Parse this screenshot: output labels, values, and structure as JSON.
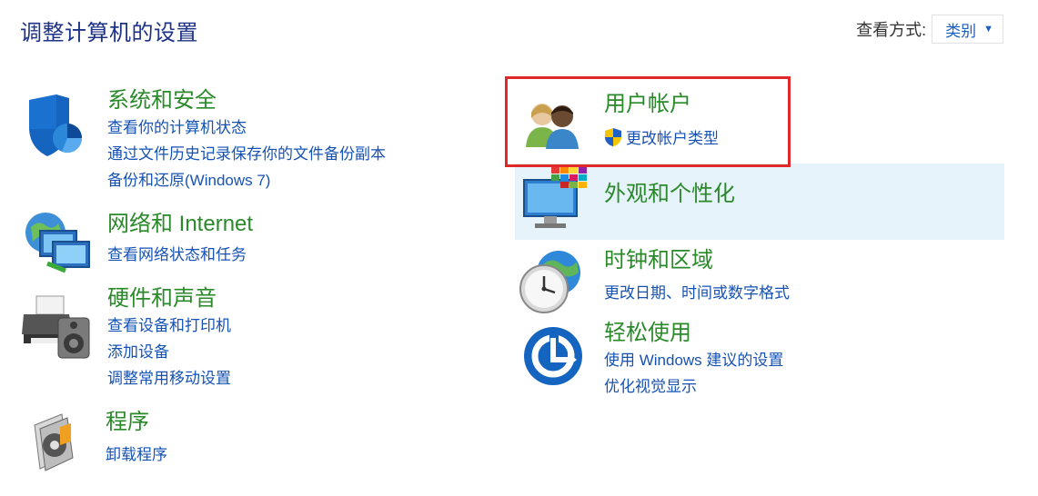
{
  "header": {
    "title": "调整计算机的设置",
    "view_by_label": "查看方式:",
    "view_by_value": "类别"
  },
  "left_categories": [
    {
      "title": "系统和安全",
      "icon": "shield-icon",
      "links": [
        "查看你的计算机状态",
        "通过文件历史记录保存你的文件备份副本",
        "备份和还原(Windows 7)"
      ]
    },
    {
      "title": "网络和 Internet",
      "icon": "network-icon",
      "links": [
        "查看网络状态和任务"
      ]
    },
    {
      "title": "硬件和声音",
      "icon": "printer-speaker-icon",
      "links": [
        "查看设备和打印机",
        "添加设备",
        "调整常用移动设置"
      ]
    },
    {
      "title": "程序",
      "icon": "programs-icon",
      "links": [
        "卸载程序"
      ]
    }
  ],
  "right_categories": [
    {
      "title": "用户帐户",
      "icon": "users-icon",
      "links": [
        "更改帐户类型"
      ]
    },
    {
      "title": "外观和个性化",
      "icon": "monitor-palette-icon",
      "links": []
    },
    {
      "title": "时钟和区域",
      "icon": "clock-globe-icon",
      "links": [
        "更改日期、时间或数字格式"
      ]
    },
    {
      "title": "轻松使用",
      "icon": "ease-of-access-icon",
      "links": [
        "使用 Windows 建议的设置",
        "优化视觉显示"
      ]
    }
  ],
  "colors": {
    "title_green": "#2a8a2a",
    "link_blue": "#1652b4",
    "highlight_bg": "#e6f3fb",
    "annotation_red": "#e0282a"
  }
}
